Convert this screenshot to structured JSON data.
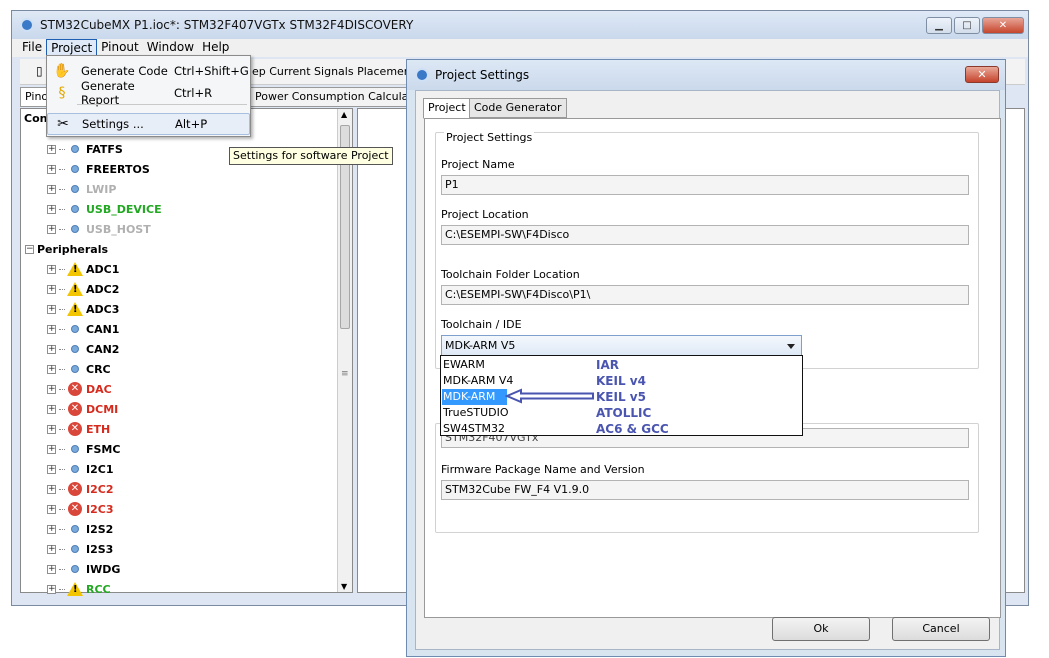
{
  "main_window": {
    "title": "STM32CubeMX P1.ioc*: STM32F407VGTx STM32F4DISCOVERY",
    "menu": [
      "File",
      "Project",
      "Pinout",
      "Window",
      "Help"
    ],
    "toolbar_text": "ep Current Signals Placement",
    "tabs": [
      "Pino",
      "Power Consumption Calculator"
    ],
    "tree_header": "Con",
    "tree": [
      {
        "label": "FATFS",
        "icon": "info",
        "color": "#000000"
      },
      {
        "label": "FREERTOS",
        "icon": "info",
        "color": "#000000"
      },
      {
        "label": "LWIP",
        "icon": "info",
        "color": "#b0b0b0"
      },
      {
        "label": "USB_DEVICE",
        "icon": "info",
        "color": "#22a822"
      },
      {
        "label": "USB_HOST",
        "icon": "info",
        "color": "#b0b0b0"
      },
      {
        "label": "Peripherals",
        "icon": "none",
        "color": "#000000"
      },
      {
        "label": "ADC1",
        "icon": "warn",
        "color": "#000000"
      },
      {
        "label": "ADC2",
        "icon": "warn",
        "color": "#000000"
      },
      {
        "label": "ADC3",
        "icon": "warn",
        "color": "#000000"
      },
      {
        "label": "CAN1",
        "icon": "info",
        "color": "#000000"
      },
      {
        "label": "CAN2",
        "icon": "info",
        "color": "#000000"
      },
      {
        "label": "CRC",
        "icon": "info",
        "color": "#000000"
      },
      {
        "label": "DAC",
        "icon": "err",
        "color": "#d52b1e"
      },
      {
        "label": "DCMI",
        "icon": "err",
        "color": "#d52b1e"
      },
      {
        "label": "ETH",
        "icon": "err",
        "color": "#d52b1e"
      },
      {
        "label": "FSMC",
        "icon": "info",
        "color": "#000000"
      },
      {
        "label": "I2C1",
        "icon": "info",
        "color": "#000000"
      },
      {
        "label": "I2C2",
        "icon": "err",
        "color": "#d52b1e"
      },
      {
        "label": "I2C3",
        "icon": "err",
        "color": "#d52b1e"
      },
      {
        "label": "I2S2",
        "icon": "info",
        "color": "#000000"
      },
      {
        "label": "I2S3",
        "icon": "info",
        "color": "#000000"
      },
      {
        "label": "IWDG",
        "icon": "info",
        "color": "#000000"
      },
      {
        "label": "RCC",
        "icon": "warn",
        "color": "#22a822"
      }
    ]
  },
  "project_menu": {
    "items": [
      {
        "label": "Generate Code",
        "accel": "Ctrl+Shift+G",
        "icon": "gear-hand-icon"
      },
      {
        "label": "Generate Report",
        "accel": "Ctrl+R",
        "icon": "scroll-icon"
      },
      {
        "label": "Settings ...",
        "accel": "Alt+P",
        "icon": "tools-icon"
      }
    ],
    "tooltip": "Settings for software Project"
  },
  "dialog": {
    "title": "Project Settings",
    "close": "✕",
    "tabs": [
      "Project",
      "Code Generator"
    ],
    "group_title": "Project Settings",
    "project_name_label": "Project Name",
    "project_name": "P1",
    "project_location_label": "Project Location",
    "project_location": "C:\\ESEMPI-SW\\F4Disco",
    "toolchain_folder_label": "Toolchain Folder Location",
    "toolchain_folder": "C:\\ESEMPI-SW\\F4Disco\\P1\\",
    "toolchain_label": "Toolchain / IDE",
    "toolchain_value": "MDK-ARM V5",
    "toolchain_options": [
      "EWARM",
      "MDK-ARM V4",
      "MDK-ARM V5",
      "TrueSTUDIO",
      "SW4STM32"
    ],
    "annotations": [
      "IAR",
      "KEIL v4",
      "KEIL v5",
      "ATOLLIC",
      "AC6 & GCC"
    ],
    "partial_field": "STM32F407VGTx",
    "firmware_label": "Firmware Package Name and Version",
    "firmware_value": "STM32Cube FW_F4 V1.9.0",
    "ok": "Ok",
    "cancel": "Cancel"
  }
}
